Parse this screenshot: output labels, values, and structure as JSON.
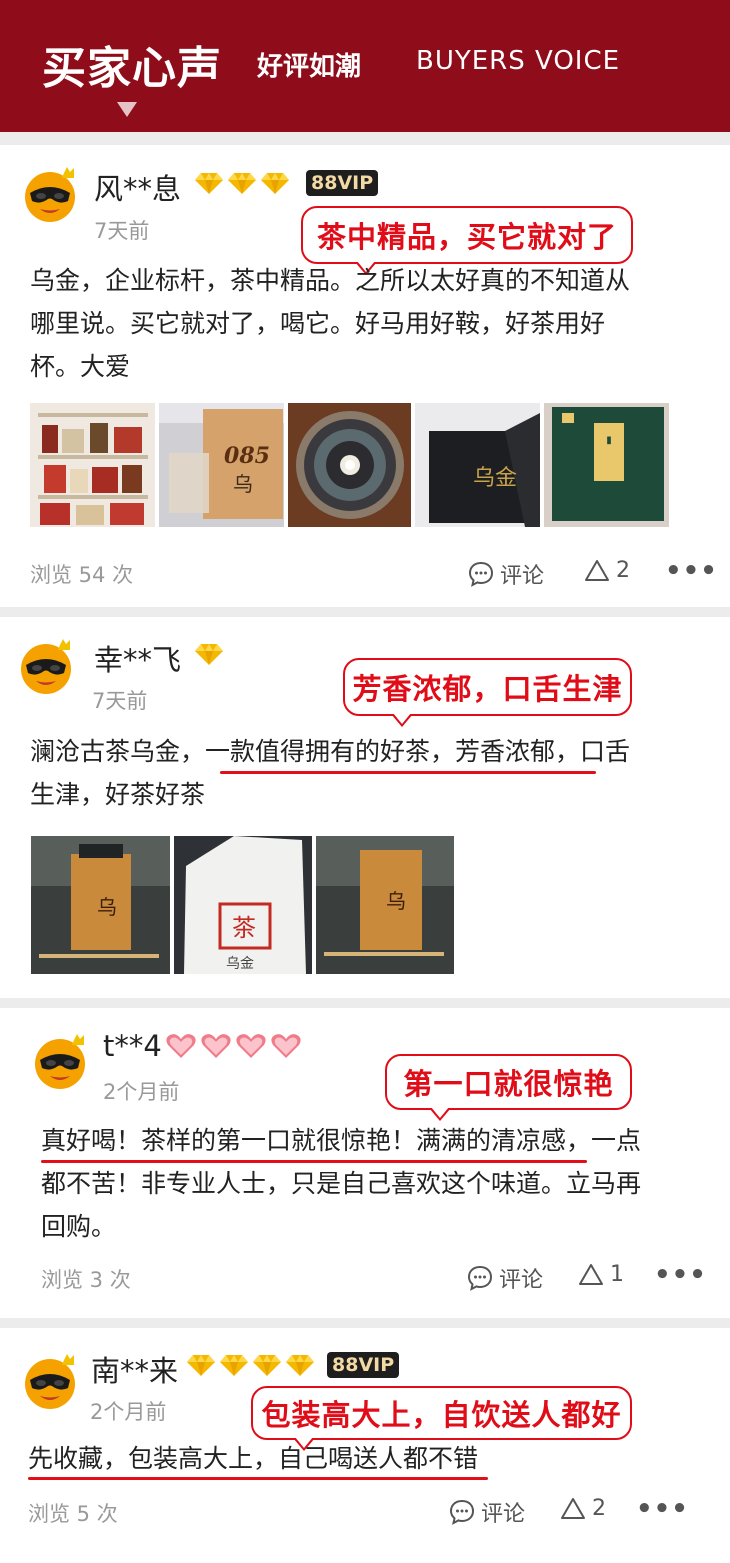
{
  "header": {
    "title": "买家心声",
    "subtitle": "好评如潮",
    "english": "BUYERS VOICE"
  },
  "reviews": [
    {
      "user": "风**息",
      "vip": "88VIP",
      "time": "7天前",
      "highlight": "茶中精品，买它就对了",
      "text": [
        "乌金，企业标杆，茶中精品。之所以太好真的不知道从",
        "哪里说。买它就对了，喝它。好马用好鞍，好茶用好",
        "杯。大爱"
      ],
      "views": "浏览 54 次",
      "comment_label": "评论",
      "likes": "2",
      "more": "•••"
    },
    {
      "user": "幸**飞",
      "time": "7天前",
      "highlight": "芳香浓郁，口舌生津",
      "text": [
        "澜沧古茶乌金，一款值得拥有的好茶，芳香浓郁，口舌",
        "生津，好茶好茶"
      ]
    },
    {
      "user": "t**4",
      "time": "2个月前",
      "highlight": "第一口就很惊艳",
      "text": [
        "真好喝！茶样的第一口就很惊艳！满满的清凉感，一点",
        "都不苦！非专业人士，只是自己喜欢这个味道。立马再",
        "回购。"
      ],
      "views": "浏览 3 次",
      "comment_label": "评论",
      "likes": "1",
      "more": "•••"
    },
    {
      "user": "南**来",
      "vip": "88VIP",
      "time": "2个月前",
      "highlight": "包装高大上，自饮送人都好",
      "text": [
        "先收藏，包装高大上，自己喝送人都不错"
      ],
      "views": "浏览 5 次",
      "comment_label": "评论",
      "likes": "2",
      "more": "•••"
    }
  ],
  "icons": {
    "comment": "comment-bubble-icon",
    "like": "like-triangle-icon",
    "diamond": "diamond-badge-icon",
    "heart": "heart-badge-icon"
  },
  "colors": {
    "header_bg": "#8f0d1a",
    "accent_red": "#e00d18",
    "diamond_gold": "#f5b800"
  }
}
